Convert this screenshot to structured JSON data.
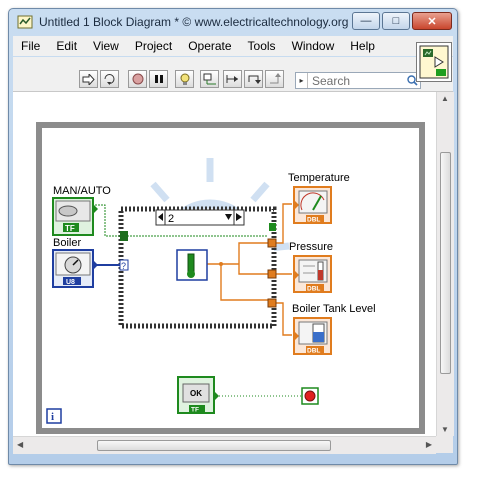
{
  "window": {
    "title": "Untitled 1 Block Diagram * © www.electricaltechnology.org",
    "minimize": "—",
    "maximize": "□",
    "close": "✕"
  },
  "menu": [
    "File",
    "Edit",
    "View",
    "Project",
    "Operate",
    "Tools",
    "Window",
    "Help"
  ],
  "search": {
    "placeholder": "Search",
    "arrow": "▸"
  },
  "diagram": {
    "labels": {
      "man_auto": "MAN/AUTO",
      "boiler": "Boiler",
      "temperature": "Temperature",
      "pressure": "Pressure",
      "tank_level": "Boiler Tank Level"
    },
    "case_selector": "2",
    "terminals": {
      "tf": "TF",
      "u8": "U8",
      "dbl": "DBL",
      "ok": "OK",
      "tick": "?"
    },
    "info": "i"
  },
  "colors": {
    "boolean_wire": "#1e8a1e",
    "numeric_wire": "#e07c1e",
    "integer_wire": "#1f3ea0",
    "diagram_frame": "#8c8c8c"
  }
}
